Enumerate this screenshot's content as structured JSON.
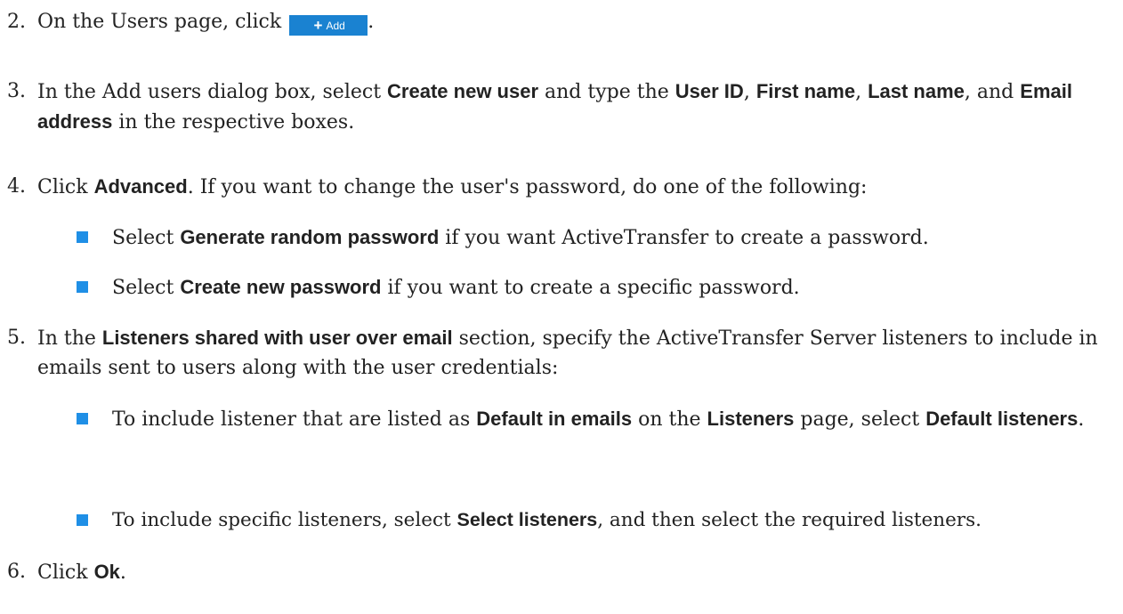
{
  "steps": [
    {
      "number": "2.",
      "text_before": "On the Users page, click ",
      "button": {
        "icon": "plus-icon",
        "label": "Add"
      },
      "text_after": "."
    },
    {
      "number": "3.",
      "parts": [
        "In the Add users dialog box, select ",
        "Create new user",
        " and type the ",
        "User ID",
        ", ",
        "First name",
        ", ",
        "Last name",
        ", and ",
        "Email address",
        " in the respective boxes."
      ]
    },
    {
      "number": "4.",
      "parts": [
        "Click ",
        "Advanced",
        ". If you want to change the user's password, do one of the following:"
      ],
      "bullets": [
        {
          "parts": [
            "Select ",
            "Generate random password",
            " if you want ActiveTransfer to create a password."
          ]
        },
        {
          "parts": [
            "Select ",
            "Create new password",
            " if you want to create a specific password."
          ]
        }
      ]
    },
    {
      "number": "5.",
      "parts": [
        "In the ",
        "Listeners shared with user over email",
        " section, specify the ActiveTransfer Server listeners to include in emails sent to users along with the user credentials:"
      ],
      "bullets": [
        {
          "parts": [
            "To include listener that are listed as ",
            "Default in emails",
            " on the ",
            "Listeners",
            " page, select ",
            "Default listeners",
            "."
          ]
        },
        {
          "parts": [
            "To include specific listeners, select ",
            "Select listeners",
            ", and then select the required listeners."
          ]
        }
      ]
    },
    {
      "number": "6.",
      "parts": [
        "Click ",
        "Ok",
        "."
      ]
    }
  ],
  "colors": {
    "bullet": "#1f8fe6",
    "add_button": "#1a82d1",
    "text": "#222222"
  }
}
